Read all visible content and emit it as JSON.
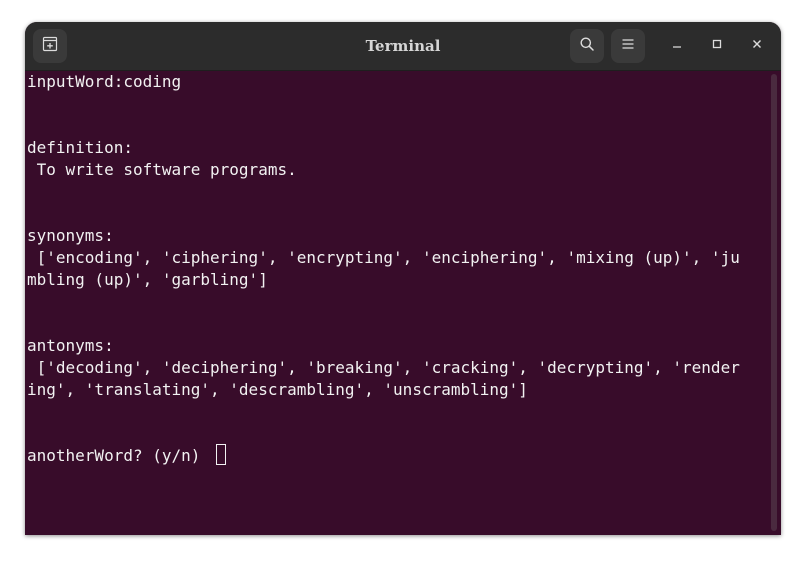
{
  "window": {
    "title": "Terminal"
  },
  "icons": {
    "new_tab": "new-tab-icon",
    "search": "search-icon",
    "menu": "hamburger-menu-icon",
    "minimize": "minimize-icon",
    "maximize": "maximize-icon",
    "close": "close-icon"
  },
  "colors": {
    "terminal_bg": "#380c2a",
    "titlebar_bg": "#2c2c2c",
    "text": "#f2f2f2"
  },
  "terminal": {
    "lines": [
      "inputWord:coding",
      "",
      "",
      "definition:",
      " To write software programs.",
      "",
      "",
      "synonyms:",
      " ['encoding', 'ciphering', 'encrypting', 'enciphering', 'mixing (up)', 'ju",
      "mbling (up)', 'garbling']",
      "",
      "",
      "antonyms:",
      " ['decoding', 'deciphering', 'breaking', 'cracking', 'decrypting', 'render",
      "ing', 'translating', 'descrambling', 'unscrambling']",
      "",
      "",
      "anotherWord? (y/n) "
    ]
  }
}
